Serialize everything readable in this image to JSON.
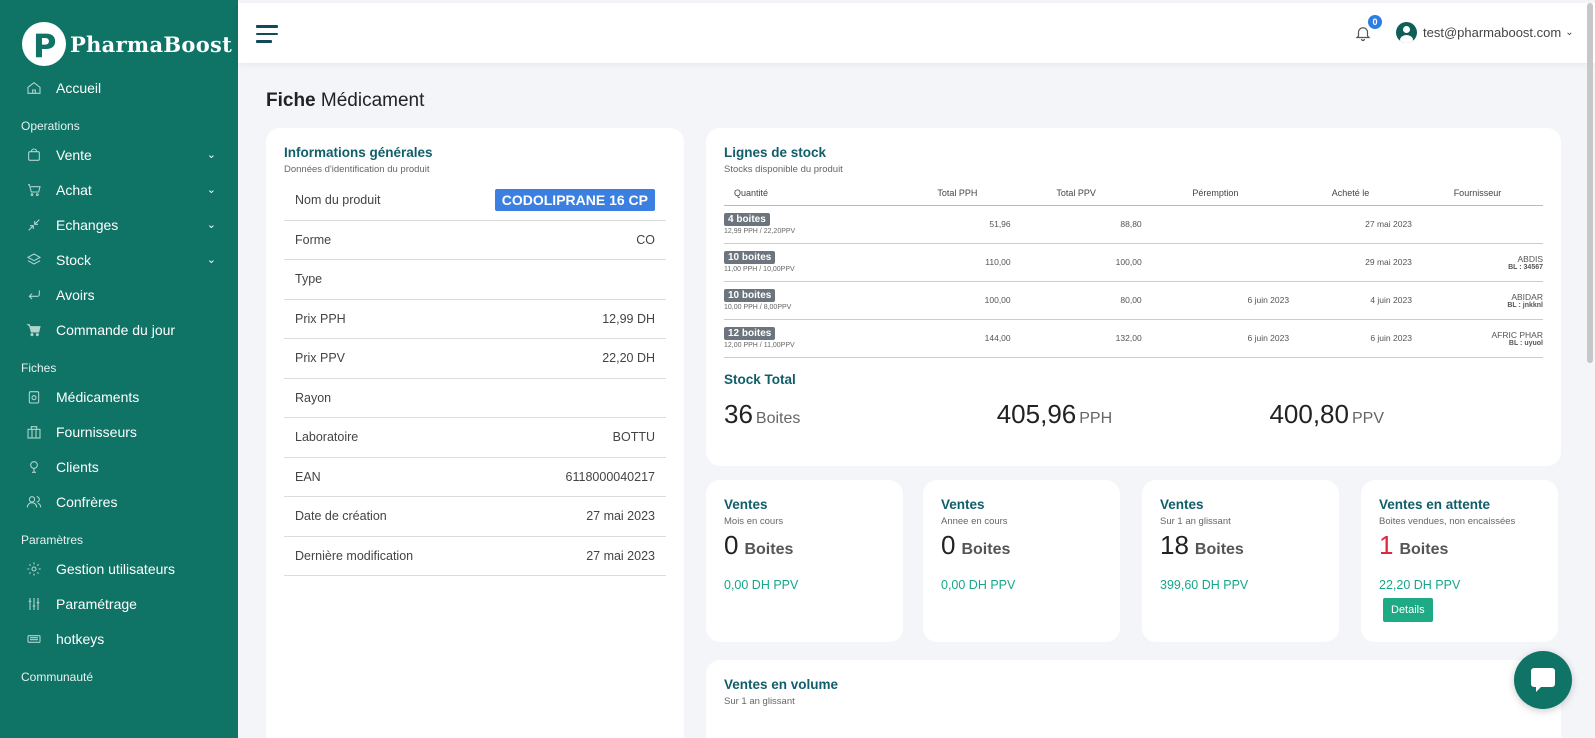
{
  "brand": {
    "name": "PharmaBoost",
    "logo_letter": "P"
  },
  "sidebar": {
    "items": [
      {
        "label": "Accueil",
        "icon": "home-icon",
        "type": "item"
      },
      {
        "label": "Operations",
        "type": "section"
      },
      {
        "label": "Vente",
        "icon": "bag-icon",
        "type": "item",
        "chevron": "⌄"
      },
      {
        "label": "Achat",
        "icon": "cart-icon",
        "type": "item",
        "chevron": "⌄"
      },
      {
        "label": "Echanges",
        "icon": "exchange-icon",
        "type": "item",
        "chevron": "⌄"
      },
      {
        "label": "Stock",
        "icon": "layers-icon",
        "type": "item",
        "chevron": "⌄"
      },
      {
        "label": "Avoirs",
        "icon": "return-icon",
        "type": "item"
      },
      {
        "label": "Commande du jour",
        "icon": "cart-solid-icon",
        "type": "item"
      },
      {
        "label": "Fiches",
        "type": "section"
      },
      {
        "label": "Médicaments",
        "icon": "medicine-icon",
        "type": "item"
      },
      {
        "label": "Fournisseurs",
        "icon": "building-icon",
        "type": "item"
      },
      {
        "label": "Clients",
        "icon": "user-icon",
        "type": "item"
      },
      {
        "label": "Confrères",
        "icon": "users-icon",
        "type": "item"
      },
      {
        "label": "Paramètres",
        "type": "section"
      },
      {
        "label": "Gestion utilisateurs",
        "icon": "gear-icon",
        "type": "item"
      },
      {
        "label": "Paramétrage",
        "icon": "sliders-icon",
        "type": "item"
      },
      {
        "label": "hotkeys",
        "icon": "keyboard-icon",
        "type": "item"
      },
      {
        "label": "Communauté",
        "type": "section"
      }
    ]
  },
  "topbar": {
    "notifications": "0",
    "user_email": "test@pharmaboost.com"
  },
  "page": {
    "title_bold": "Fiche",
    "title_rest": "Médicament"
  },
  "info": {
    "title": "Informations générales",
    "subtitle": "Données d'identification du produit",
    "rows": [
      {
        "label": "Nom du produit",
        "value": "CODOLIPRANE 16 CP",
        "badge": true
      },
      {
        "label": "Forme",
        "value": "CO"
      },
      {
        "label": "Type",
        "value": ""
      },
      {
        "label": "Prix PPH",
        "value": "12,99 DH"
      },
      {
        "label": "Prix PPV",
        "value": "22,20 DH"
      },
      {
        "label": "Rayon",
        "value": ""
      },
      {
        "label": "Laboratoire",
        "value": "BOTTU"
      },
      {
        "label": "EAN",
        "value": "6118000040217"
      },
      {
        "label": "Date de création",
        "value": "27 mai 2023"
      },
      {
        "label": "Dernière modification",
        "value": "27 mai 2023"
      }
    ]
  },
  "stock": {
    "title": "Lignes de stock",
    "subtitle": "Stocks disponible du produit",
    "columns": [
      "Quantité",
      "Total PPH",
      "Total PPV",
      "Péremption",
      "Acheté le",
      "Fournisseur"
    ],
    "rows": [
      {
        "qty": "4 boites",
        "prices": "12,99 PPH / 22,20PPV",
        "pph": "51,96",
        "ppv": "88,80",
        "peremption": "",
        "achete": "27 mai 2023",
        "fournisseur": "",
        "bl": ""
      },
      {
        "qty": "10 boites",
        "prices": "11,00 PPH / 10,00PPV",
        "pph": "110,00",
        "ppv": "100,00",
        "peremption": "",
        "achete": "29 mai 2023",
        "fournisseur": "ABDIS",
        "bl": "BL : 34567"
      },
      {
        "qty": "10 boites",
        "prices": "10,00 PPH / 8,00PPV",
        "pph": "100,00",
        "ppv": "80,00",
        "peremption": "6 juin 2023",
        "achete": "4 juin 2023",
        "fournisseur": "ABIDAR",
        "bl": "BL : jnkknl"
      },
      {
        "qty": "12 boites",
        "prices": "12,00 PPH / 11,00PPV",
        "pph": "144,00",
        "ppv": "132,00",
        "peremption": "6 juin 2023",
        "achete": "6 juin 2023",
        "fournisseur": "AFRIC PHAR",
        "bl": "BL : uyuol"
      }
    ],
    "total_title": "Stock Total",
    "totals": [
      {
        "value": "36",
        "unit": "Boites"
      },
      {
        "value": "405,96",
        "unit": "PPH"
      },
      {
        "value": "400,80",
        "unit": "PPV"
      }
    ]
  },
  "ventes": [
    {
      "title": "Ventes",
      "subtitle": "Mois en cours",
      "value": "0",
      "unit": "Boites",
      "ppv": "0,00 DH PPV"
    },
    {
      "title": "Ventes",
      "subtitle": "Annee en cours",
      "value": "0",
      "unit": "Boites",
      "ppv": "0,00 DH PPV"
    },
    {
      "title": "Ventes",
      "subtitle": "Sur 1 an glissant",
      "value": "18",
      "unit": "Boites",
      "ppv": "399,60 DH PPV"
    },
    {
      "title": "Ventes en attente",
      "subtitle": "Boites vendues, non encaissées",
      "value": "1",
      "unit": "Boites",
      "ppv": "22,20 DH PPV",
      "button": "Details"
    }
  ],
  "volume": {
    "title": "Ventes en volume",
    "subtitle": "Sur 1 an glissant"
  }
}
